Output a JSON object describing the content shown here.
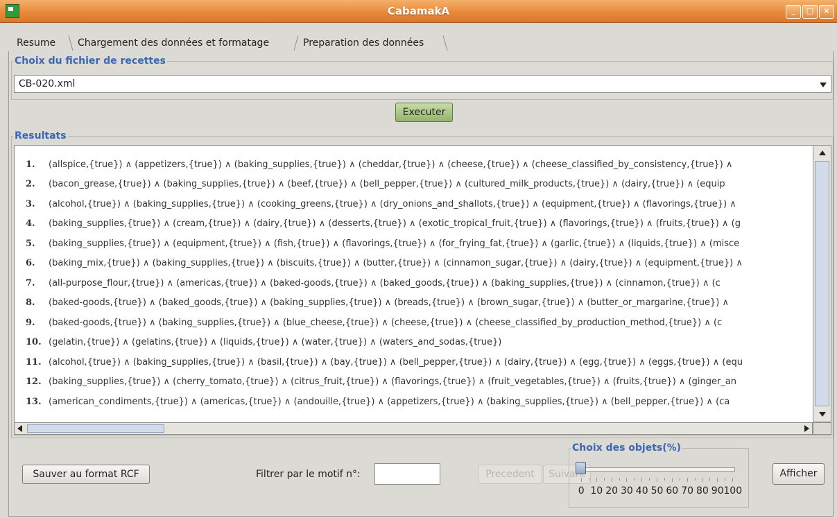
{
  "window": {
    "title": "CabamakA",
    "controls": [
      "_",
      "□",
      "×"
    ]
  },
  "tabs": [
    {
      "label": "Resume",
      "active": false
    },
    {
      "label": "Chargement des données et formatage",
      "active": true
    },
    {
      "label": "Preparation des données",
      "active": false
    }
  ],
  "file_group": {
    "legend": "Choix du fichier de recettes",
    "selected": "CB-020.xml",
    "execute_label": "Executer"
  },
  "results": {
    "legend": "Resultats",
    "rows": [
      {
        "num": "1.",
        "text": "(allspice,{true}) ∧ (appetizers,{true}) ∧ (baking_supplies,{true}) ∧ (cheddar,{true}) ∧ (cheese,{true}) ∧ (cheese_classified_by_consistency,{true}) ∧"
      },
      {
        "num": "2.",
        "text": "(bacon_grease,{true}) ∧ (baking_supplies,{true}) ∧ (beef,{true}) ∧ (bell_pepper,{true}) ∧ (cultured_milk_products,{true}) ∧ (dairy,{true}) ∧ (equip"
      },
      {
        "num": "3.",
        "text": "(alcohol,{true}) ∧ (baking_supplies,{true}) ∧ (cooking_greens,{true}) ∧ (dry_onions_and_shallots,{true}) ∧ (equipment,{true}) ∧ (flavorings,{true}) ∧"
      },
      {
        "num": "4.",
        "text": "(baking_supplies,{true}) ∧ (cream,{true}) ∧ (dairy,{true}) ∧ (desserts,{true}) ∧ (exotic_tropical_fruit,{true}) ∧ (flavorings,{true}) ∧ (fruits,{true}) ∧ (g"
      },
      {
        "num": "5.",
        "text": "(baking_supplies,{true}) ∧ (equipment,{true}) ∧ (fish,{true}) ∧ (flavorings,{true}) ∧ (for_frying_fat,{true}) ∧ (garlic,{true}) ∧ (liquids,{true}) ∧ (misce"
      },
      {
        "num": "6.",
        "text": "(baking_mix,{true}) ∧ (baking_supplies,{true}) ∧ (biscuits,{true}) ∧ (butter,{true}) ∧ (cinnamon_sugar,{true}) ∧ (dairy,{true}) ∧ (equipment,{true}) ∧"
      },
      {
        "num": "7.",
        "text": "(all-purpose_flour,{true}) ∧ (americas,{true}) ∧ (baked-goods,{true}) ∧ (baked_goods,{true}) ∧ (baking_supplies,{true}) ∧ (cinnamon,{true}) ∧ (c"
      },
      {
        "num": "8.",
        "text": "(baked-goods,{true}) ∧ (baked_goods,{true}) ∧ (baking_supplies,{true}) ∧ (breads,{true}) ∧ (brown_sugar,{true}) ∧ (butter_or_margarine,{true}) ∧"
      },
      {
        "num": "9.",
        "text": "(baked-goods,{true}) ∧ (baking_supplies,{true}) ∧ (blue_cheese,{true}) ∧ (cheese,{true}) ∧ (cheese_classified_by_production_method,{true}) ∧ (c"
      },
      {
        "num": "10.",
        "text": "(gelatin,{true}) ∧ (gelatins,{true}) ∧ (liquids,{true}) ∧ (water,{true}) ∧ (waters_and_sodas,{true})"
      },
      {
        "num": "11.",
        "text": "(alcohol,{true}) ∧ (baking_supplies,{true}) ∧ (basil,{true}) ∧ (bay,{true}) ∧ (bell_pepper,{true}) ∧ (dairy,{true}) ∧ (egg,{true}) ∧ (eggs,{true}) ∧ (equ"
      },
      {
        "num": "12.",
        "text": "(baking_supplies,{true}) ∧ (cherry_tomato,{true}) ∧ (citrus_fruit,{true}) ∧ (flavorings,{true}) ∧ (fruit_vegetables,{true}) ∧ (fruits,{true}) ∧ (ginger_an"
      },
      {
        "num": "13.",
        "text": "(american_condiments,{true}) ∧ (americas,{true}) ∧ (andouille,{true}) ∧ (appetizers,{true}) ∧ (baking_supplies,{true}) ∧ (bell_pepper,{true}) ∧ (ca"
      }
    ]
  },
  "bottom": {
    "save_label": "Sauver au format RCF",
    "filter_label": "Filtrer par le motif n°:",
    "filter_value": "",
    "prev_label": "Precedent",
    "next_label": "Suivant",
    "objects_legend": "Choix des objets(%)",
    "slider_value_percent": 0,
    "slider_ticks": [
      "0",
      "10",
      "20",
      "30",
      "40",
      "50",
      "60",
      "70",
      "80",
      "90",
      "100"
    ],
    "show_label": "Afficher"
  }
}
